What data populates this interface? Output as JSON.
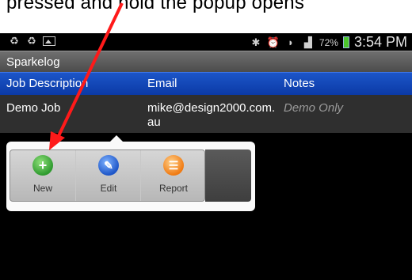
{
  "caption": {
    "text": "pressed and hold the popup opens"
  },
  "statusbar": {
    "battery": "72%",
    "time": "3:54 PM"
  },
  "app": {
    "title": "Sparkelog"
  },
  "table": {
    "headers": [
      "Job Description",
      "Email",
      "Notes"
    ],
    "rows": [
      {
        "job": "Demo Job",
        "email_line1": "mike@design2000.com.",
        "email_line2": "au",
        "notes": "Demo Only"
      }
    ]
  },
  "popup": {
    "buttons": [
      {
        "label": "New",
        "icon": "plus-icon"
      },
      {
        "label": "Edit",
        "icon": "pencil-icon"
      },
      {
        "label": "Report",
        "icon": "report-icon"
      }
    ]
  },
  "colors": {
    "header_blue": "#0b3aa6",
    "arrow_red": "#ff1a1a",
    "new_green": "#2e9a2e",
    "edit_blue": "#1e56c8",
    "report_orange": "#f07a12"
  }
}
